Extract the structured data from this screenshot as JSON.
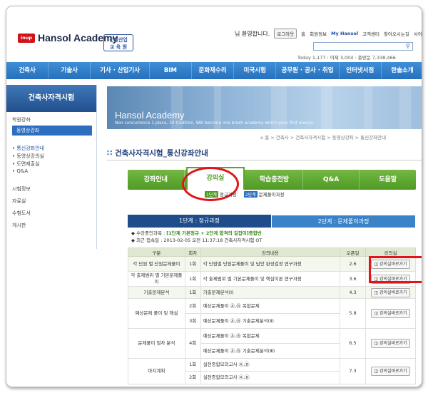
{
  "header": {
    "logo_badge": "inup",
    "logo_text": "Hansol Academy",
    "sub_badge_line1": "건설산업",
    "sub_badge_line2": "교 육 원",
    "greeting": "님 환영합니다.",
    "logout": "로그아웃",
    "links": [
      "홈",
      "회원정보",
      "My Hansol",
      "고객센터",
      "찾아오시는길",
      "사이트맵"
    ],
    "today_text": "Today 1,177 : 어제 3,004 : 총방문 7,338,466"
  },
  "nav": {
    "items": [
      "건축사",
      "기술사",
      "기사 · 산업기사",
      "BIM",
      "문화재수리",
      "미국시험",
      "공무원 · 공사 · 취업",
      "인터넷서점",
      "한솔소개"
    ]
  },
  "sidebar": {
    "title": "건축사자격시험",
    "items": [
      "학원강좌",
      "동영상강좌",
      "• 통신강좌안내",
      "• 동영상강의실",
      "• 도면제출실",
      "• Q&A",
      "시험정보",
      "자료실",
      "수험도서",
      "게시판"
    ]
  },
  "banner": {
    "title": "Hansol Academy",
    "subtitle": "Non-concurrence 1 place, 20 tradition, Will become one brush academy which goes first always."
  },
  "breadcrumb": "⌂ 홈 > 건축사 > 건축사자격시험 > 동영상강좌 > 통신강좌안내",
  "page_title": "건축사자격시험_통신강좌안내",
  "tabs": [
    "강좌안내",
    "강의실",
    "학습충전방",
    "Q&A",
    "도움말"
  ],
  "subtabs": [
    {
      "badge": "1단계",
      "label": "정규과정"
    },
    {
      "badge": "2단계",
      "label": "문제풀이과정"
    }
  ],
  "stages": [
    "1단계 : 정규과정",
    "2단계 : 문제풀이과정"
  ],
  "info": {
    "line1_label": "◆ 수강중인과목 :",
    "line1_value": "[1단계 기본정규 + 2단계 합격의 길잡이]종합반",
    "line2": "◆ 최근 접속일 : 2013-02-05 오전 11:37:18 건축사자격시험 OT"
  },
  "table": {
    "headers": [
      "구분",
      "회차",
      "강의내용",
      "오픈일",
      "강의실"
    ],
    "rows": [
      {
        "group": "각 단원 별 단원문제풀이",
        "no": "1회",
        "content": "각 단원별 단원문제풀이 및 답안 완성검정 연구과정",
        "open": "2.6",
        "btn": "강의실바로가기"
      },
      {
        "group": "각 출제범위 별 기본문제풀이",
        "no": "1회",
        "content": "각 출제범위 별 기본문제풀이 및 핵심이론 연구과정",
        "open": "3.6",
        "btn": "강의실바로가기"
      },
      {
        "group": "기출문제분석",
        "no": "1회",
        "content": "기출문제분석(Ⅰ)",
        "open": "4.3",
        "btn": "강의실바로가기"
      },
      {
        "group": "예상문제 풀이 및 해설",
        "no": "2회",
        "content": "예상문제풀이 Ⓐ,Ⓑ 복합문제",
        "open": "5.8",
        "btn": "강의실바로가기"
      },
      {
        "group": "",
        "no": "3회",
        "content": "예상문제풀이 Ⓐ,Ⓑ 기출문제분석(Ⅱ)",
        "open": "",
        "btn": ""
      },
      {
        "group": "문제풀이 절차 분석",
        "no": "4회",
        "content": "예상문제풀이 Ⓐ,Ⓑ 복합문제",
        "open": "6.5",
        "btn": "강의실바로가기"
      },
      {
        "group": "",
        "no": "",
        "content": "예상문제풀이 Ⓐ,Ⓑ 기출문제분석(Ⅲ)",
        "open": "",
        "btn": ""
      },
      {
        "group": "마지계획",
        "no": "1회",
        "content": "실전종합모의고사 Ⓐ,Ⓑ",
        "open": "7.3",
        "btn": "강의실바로가기"
      },
      {
        "group": "",
        "no": "2회",
        "content": "실전종합모의고사 Ⓐ,Ⓑ",
        "open": "",
        "btn": ""
      }
    ]
  }
}
